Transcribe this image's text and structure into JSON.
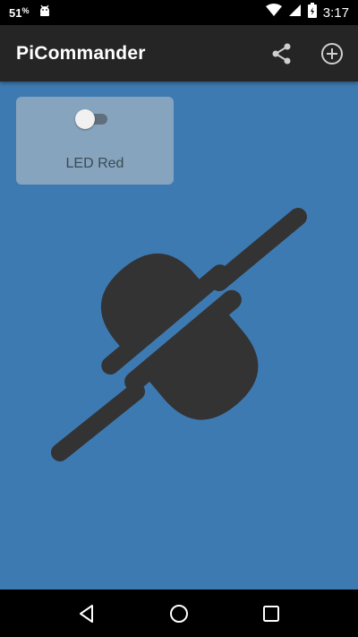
{
  "status_bar": {
    "battery_percent": "51",
    "battery_symbol": "%",
    "time": "3:17",
    "icons": [
      "battery-percent-icon",
      "android-debug-icon",
      "wifi-icon",
      "signal-icon",
      "battery-charging-icon"
    ]
  },
  "app_bar": {
    "title": "PiCommander",
    "actions": [
      "share-icon",
      "add-circle-icon"
    ]
  },
  "cards": [
    {
      "label": "LED Red",
      "switch_on": false
    }
  ],
  "illustration": "power-plug-icon",
  "nav_bar": {
    "buttons": [
      "back-icon",
      "home-icon",
      "recents-icon"
    ]
  },
  "colors": {
    "background": "#3e7ab2",
    "app_bar": "#252525",
    "card": "#86a4bd",
    "plug": "#333333"
  }
}
